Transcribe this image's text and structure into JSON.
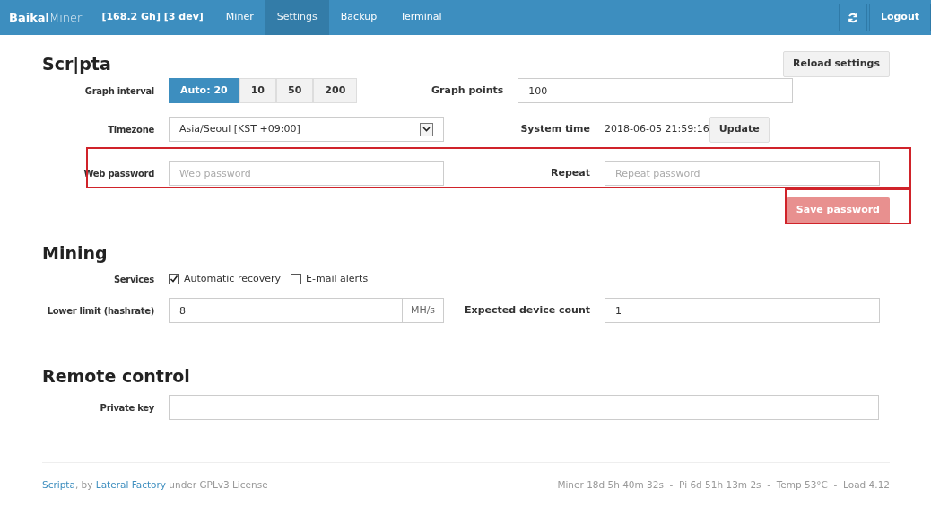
{
  "navbar": {
    "brand_bold": "Baikal",
    "brand_light": "Miner",
    "status": "[168.2 Gh] [3 dev]",
    "tabs": [
      {
        "label": "Miner",
        "selected": false
      },
      {
        "label": "Settings",
        "selected": true
      },
      {
        "label": "Backup",
        "selected": false
      },
      {
        "label": "Terminal",
        "selected": false
      }
    ],
    "logout": "Logout"
  },
  "scripta": {
    "title": "Scr|pta",
    "reload": "Reload settings",
    "graph_interval": {
      "label": "Graph interval",
      "options": [
        {
          "label": "Auto: 20",
          "selected": true
        },
        {
          "label": "10",
          "selected": false
        },
        {
          "label": "50",
          "selected": false
        },
        {
          "label": "200",
          "selected": false
        }
      ]
    },
    "graph_points": {
      "label": "Graph points",
      "value": "100"
    },
    "timezone": {
      "label": "Timezone",
      "value": "Asia/Seoul [KST +09:00]"
    },
    "system_time": {
      "label": "System time",
      "value": "2018-06-05 21:59:16",
      "button": "Update"
    },
    "web_password": {
      "label": "Web password",
      "placeholder": "Web password",
      "highlighted": true
    },
    "repeat": {
      "label": "Repeat",
      "placeholder": "Repeat password"
    },
    "save": {
      "label": "Save password",
      "disabled": true,
      "highlighted": true
    }
  },
  "mining": {
    "title": "Mining",
    "services": {
      "label": "Services",
      "options": [
        {
          "label": "Automatic recovery",
          "checked": true
        },
        {
          "label": "E-mail alerts",
          "checked": false
        }
      ]
    },
    "lower_limit": {
      "label": "Lower limit (hashrate)",
      "value": "8",
      "unit": "MH/s"
    },
    "device_count": {
      "label": "Expected device count",
      "value": "1"
    }
  },
  "remote": {
    "title": "Remote control",
    "private_key": {
      "label": "Private key"
    }
  },
  "footer": {
    "credit": [
      {
        "kind": "link",
        "text": "Scripta"
      },
      {
        "kind": "text",
        "text": ", by "
      },
      {
        "kind": "link",
        "text": "Lateral Factory"
      },
      {
        "kind": "text",
        "text": " under GPLv3 License"
      }
    ],
    "stats": "Miner 18d 5h 40m 32s  -  Pi 6d 51h 13m 2s  -  Temp 53°C  -  Load 4.12"
  }
}
